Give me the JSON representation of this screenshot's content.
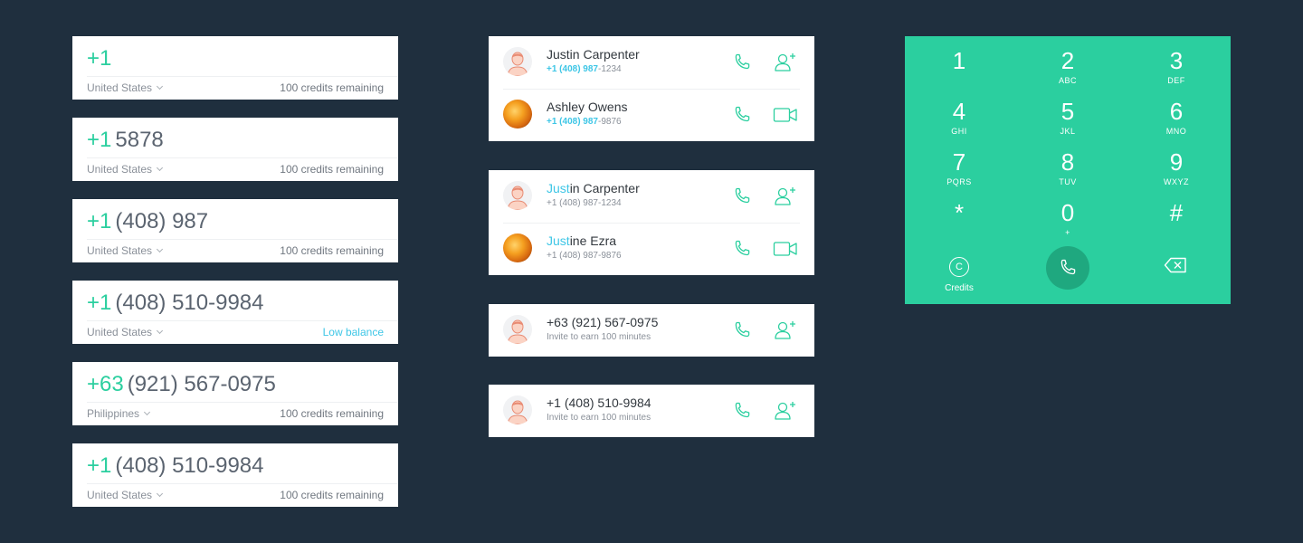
{
  "number_cards": [
    {
      "code": "+1",
      "digits": "",
      "country": "United States",
      "status": "100 credits remaining",
      "low": false
    },
    {
      "code": "+1",
      "digits": "5878",
      "country": "United States",
      "status": "100 credits remaining",
      "low": false
    },
    {
      "code": "+1",
      "digits": "(408) 987",
      "country": "United States",
      "status": "100 credits remaining",
      "low": false
    },
    {
      "code": "+1",
      "digits": "(408) 510-9984",
      "country": "United States",
      "status": "Low balance",
      "low": true
    },
    {
      "code": "+63",
      "digits": "(921) 567-0975",
      "country": "Philippines",
      "status": "100 credits remaining",
      "low": false
    },
    {
      "code": "+1",
      "digits": "(408) 510-9984",
      "country": "United States",
      "status": "100 credits remaining",
      "low": false
    }
  ],
  "contact_cards": [
    {
      "rows": [
        {
          "avatar": "person-icon",
          "name_hl": "",
          "name_rest": "Justin Carpenter",
          "sub_hl": "+1 (408) 987",
          "sub_rest": "-1234",
          "second_action": "add-contact-icon"
        },
        {
          "avatar": "photo",
          "name_hl": "",
          "name_rest": "Ashley Owens",
          "sub_hl": "+1 (408) 987",
          "sub_rest": "-9876",
          "second_action": "video-call-icon"
        }
      ]
    },
    {
      "rows": [
        {
          "avatar": "person-icon",
          "name_hl": "Just",
          "name_rest": "in Carpenter",
          "sub_hl": "",
          "sub_rest": "+1 (408) 987-1234",
          "second_action": "add-contact-icon"
        },
        {
          "avatar": "photo",
          "name_hl": "Just",
          "name_rest": "ine Ezra",
          "sub_hl": "",
          "sub_rest": "+1 (408) 987-9876",
          "second_action": "video-call-icon"
        }
      ]
    },
    {
      "rows": [
        {
          "avatar": "person-icon",
          "name_hl": "",
          "name_rest": "+63 (921) 567-0975",
          "sub_hl": "",
          "sub_rest": "Invite to earn 100 minutes",
          "second_action": "add-contact-icon"
        }
      ]
    },
    {
      "rows": [
        {
          "avatar": "person-icon",
          "name_hl": "",
          "name_rest": "+1 (408) 510-9984",
          "sub_hl": "",
          "sub_rest": "Invite to earn 100 minutes",
          "second_action": "add-contact-icon"
        }
      ]
    }
  ],
  "dialpad": {
    "keys": [
      {
        "digit": "1",
        "letters": ""
      },
      {
        "digit": "2",
        "letters": "ABC"
      },
      {
        "digit": "3",
        "letters": "DEF"
      },
      {
        "digit": "4",
        "letters": "GHI"
      },
      {
        "digit": "5",
        "letters": "JKL"
      },
      {
        "digit": "6",
        "letters": "MNO"
      },
      {
        "digit": "7",
        "letters": "PQRS"
      },
      {
        "digit": "8",
        "letters": "TUV"
      },
      {
        "digit": "9",
        "letters": "WXYZ"
      },
      {
        "digit": "*",
        "letters": ""
      },
      {
        "digit": "0",
        "letters": "+"
      },
      {
        "digit": "#",
        "letters": ""
      }
    ],
    "credits_symbol": "C",
    "credits_label": "Credits",
    "call_icon": "phone-icon",
    "backspace_icon": "backspace-icon"
  },
  "colors": {
    "background": "#1f2f3e",
    "accent_green": "#2bcf9f",
    "accent_blue": "#3ec6e6",
    "call_button": "#1fa87f"
  }
}
